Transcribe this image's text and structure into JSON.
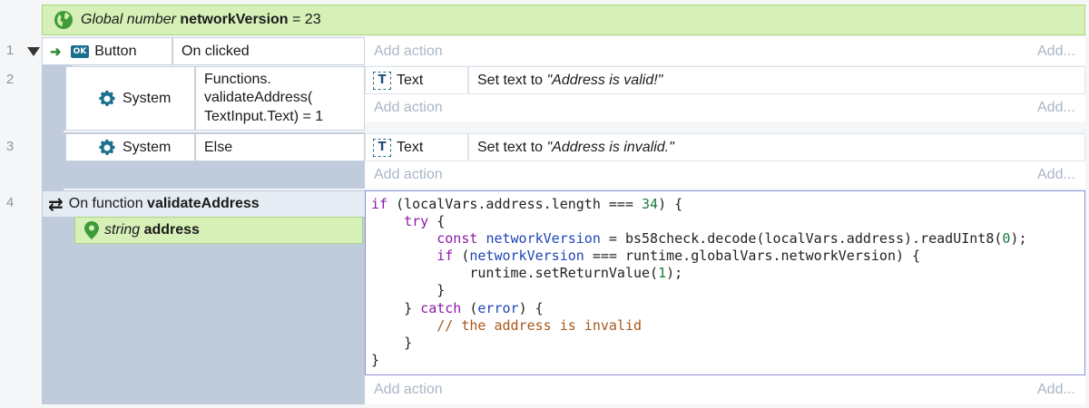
{
  "global_var": {
    "prefix": "Global number",
    "name": "networkVersion",
    "value_text": "= 23"
  },
  "line_numbers": [
    "1",
    "2",
    "3",
    "4"
  ],
  "event1": {
    "object_badge": "OK",
    "object": "Button",
    "condition": "On clicked",
    "add_action": "Add action",
    "add": "Add..."
  },
  "event2": {
    "object": "System",
    "condition_line1": "Functions.",
    "condition_line2": "validateAddress(",
    "condition_line3": "TextInput.Text) = 1",
    "action_object": "Text",
    "action_text_prefix": "Set text to ",
    "action_text_value": "\"Address is valid!\"",
    "add_action": "Add action",
    "add": "Add..."
  },
  "event3": {
    "object": "System",
    "condition": "Else",
    "action_object": "Text",
    "action_text_prefix": "Set text to ",
    "action_text_value": "\"Address is invalid.\"",
    "add_action": "Add action",
    "add": "Add..."
  },
  "event4": {
    "title_prefix": "On function ",
    "title_name": "validateAddress",
    "param_type": "string",
    "param_name": "address",
    "add_action": "Add action",
    "add": "Add..."
  },
  "code_lines": [
    "if (localVars.address.length === 34) {",
    "    try {",
    "        const networkVersion = bs58check.decode(localVars.address).readUInt8(0);",
    "        if (networkVersion === runtime.globalVars.networkVersion) {",
    "            runtime.setReturnValue(1);",
    "        }",
    "    } catch (error) {",
    "        // the address is invalid",
    "    }",
    "}"
  ],
  "colors": {
    "green_bar": "#d6f0b8",
    "side_panel": "#c0ccdb",
    "code_border": "#8d8fe0",
    "keyword": "#8b1aa8",
    "identifier": "#1f45b8",
    "comment": "#a8571a"
  }
}
